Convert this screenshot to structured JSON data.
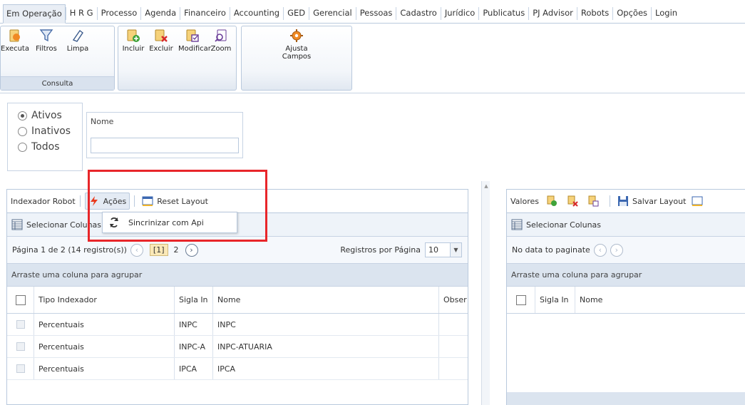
{
  "menu": {
    "tabs": [
      "Em Operação",
      "H R G",
      "Processo",
      "Agenda",
      "Financeiro",
      "Accounting",
      "GED",
      "Gerencial",
      "Pessoas",
      "Cadastro",
      "Jurídico",
      "Publicatus",
      "PJ Advisor",
      "Robots",
      "Opções",
      "Login"
    ],
    "active_index": 0
  },
  "ribbon": {
    "consulta": {
      "caption": "Consulta",
      "executa": "Executa",
      "filtros": "Filtros",
      "limpa": "Limpa"
    },
    "edit": {
      "incluir": "Incluir",
      "excluir": "Excluir",
      "modificar": "Modificar",
      "zoom": "Zoom"
    },
    "ajusta": {
      "line1": "Ajusta",
      "line2": "Campos"
    }
  },
  "filters": {
    "status_options": [
      "Ativos",
      "Inativos",
      "Todos"
    ],
    "status_selected": 0,
    "name_label": "Nome",
    "name_value": ""
  },
  "left_panel": {
    "title": "Indexador Robot",
    "acoes": "Ações",
    "reset_layout": "Reset Layout",
    "select_columns": "Selecionar Colunas",
    "pager_text": "Página 1 de 2 (14 registro(s))",
    "current_page": "[1]",
    "next_page": "2",
    "per_page_label": "Registros por Página",
    "per_page_value": "10",
    "group_hint": "Arraste uma coluna para agrupar",
    "columns": [
      "Tipo Indexador",
      "Sigla In",
      "Nome",
      "Obser"
    ],
    "rows": [
      {
        "tipo": "Percentuais",
        "sigla": "INPC",
        "nome": "INPC"
      },
      {
        "tipo": "Percentuais",
        "sigla": "INPC-A",
        "nome": "INPC-ATUARIA"
      },
      {
        "tipo": "Percentuais",
        "sigla": "IPCA",
        "nome": "IPCA"
      }
    ]
  },
  "dropdown": {
    "sync": "Sincrinizar com Api"
  },
  "right_panel": {
    "title": "Valores",
    "save_layout": "Salvar Layout",
    "select_columns": "Selecionar Colunas",
    "no_data": "No data to paginate",
    "group_hint": "Arraste uma coluna para agrupar",
    "columns": [
      "Sigla In",
      "Nome"
    ]
  },
  "colors": {
    "highlight": "#e8262a",
    "panel_border": "#b9c9dd",
    "group_bar": "#dbe4ef"
  }
}
